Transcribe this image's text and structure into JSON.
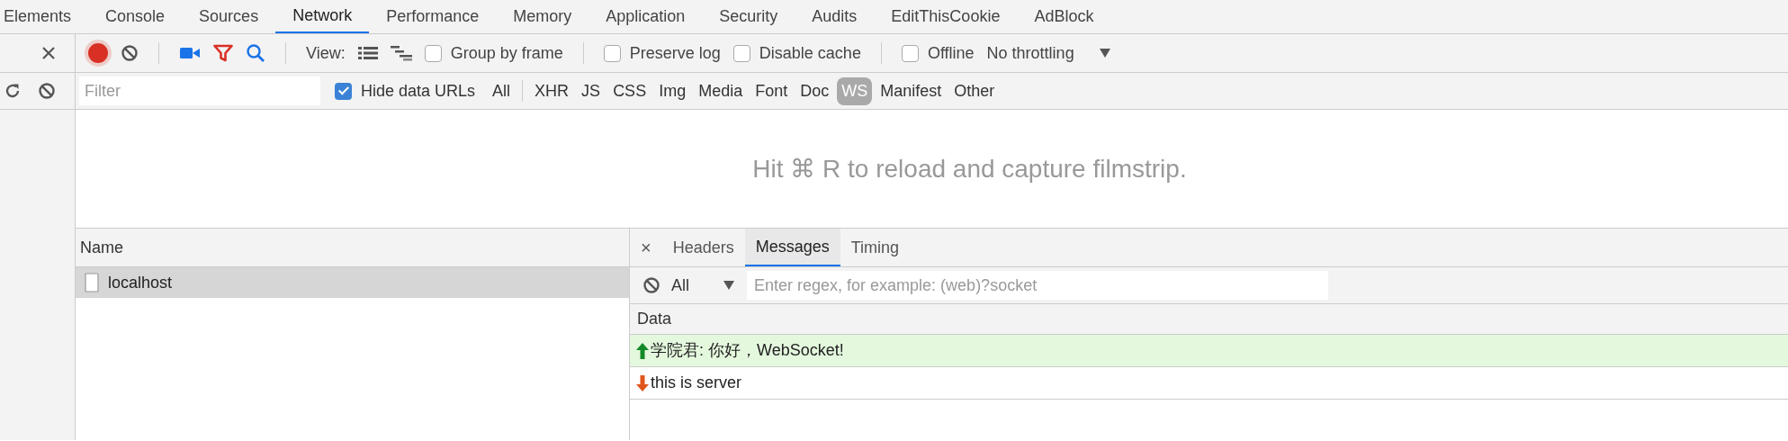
{
  "panel_tabs": [
    {
      "label": "Elements",
      "selected": false
    },
    {
      "label": "Console",
      "selected": false
    },
    {
      "label": "Sources",
      "selected": false
    },
    {
      "label": "Network",
      "selected": true
    },
    {
      "label": "Performance",
      "selected": false
    },
    {
      "label": "Memory",
      "selected": false
    },
    {
      "label": "Application",
      "selected": false
    },
    {
      "label": "Security",
      "selected": false
    },
    {
      "label": "Audits",
      "selected": false
    },
    {
      "label": "EditThisCookie",
      "selected": false
    },
    {
      "label": "AdBlock",
      "selected": false
    }
  ],
  "toolbar": {
    "recording": true,
    "view_label": "View:",
    "options": [
      {
        "label": "Group by frame",
        "checked": false
      },
      {
        "label": "Preserve log",
        "checked": false
      },
      {
        "label": "Disable cache",
        "checked": false
      },
      {
        "label": "Offline",
        "checked": false
      }
    ],
    "throttling": "No throttling"
  },
  "filter_bar": {
    "placeholder": "Filter",
    "hide_data_urls": {
      "label": "Hide data URLs",
      "checked": true
    },
    "types": [
      {
        "label": "All",
        "selected": false
      },
      {
        "label": "XHR",
        "selected": false
      },
      {
        "label": "JS",
        "selected": false
      },
      {
        "label": "CSS",
        "selected": false
      },
      {
        "label": "Img",
        "selected": false
      },
      {
        "label": "Media",
        "selected": false
      },
      {
        "label": "Font",
        "selected": false
      },
      {
        "label": "Doc",
        "selected": false
      },
      {
        "label": "WS",
        "selected": true
      },
      {
        "label": "Manifest",
        "selected": false
      },
      {
        "label": "Other",
        "selected": false
      }
    ]
  },
  "filmstrip_hint": "Hit ⌘ R to reload and capture filmstrip.",
  "requests": {
    "column": "Name",
    "rows": [
      {
        "name": "localhost",
        "selected": true
      }
    ]
  },
  "detail": {
    "close": "×",
    "tabs": [
      {
        "label": "Headers",
        "selected": false
      },
      {
        "label": "Messages",
        "selected": true
      },
      {
        "label": "Timing",
        "selected": false
      }
    ],
    "message_filter": {
      "type": "All",
      "placeholder": "Enter regex, for example: (web)?socket"
    },
    "column": "Data",
    "messages": [
      {
        "kind": "sent",
        "text": "学院君: 你好，WebSocket!"
      },
      {
        "kind": "received",
        "text": "this is server"
      }
    ]
  }
}
